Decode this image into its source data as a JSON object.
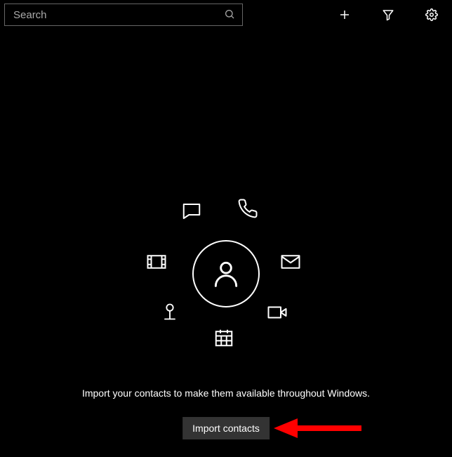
{
  "search": {
    "placeholder": "Search"
  },
  "message": "Import your contacts to make them available throughout Windows.",
  "buttons": {
    "import": "Import contacts"
  }
}
